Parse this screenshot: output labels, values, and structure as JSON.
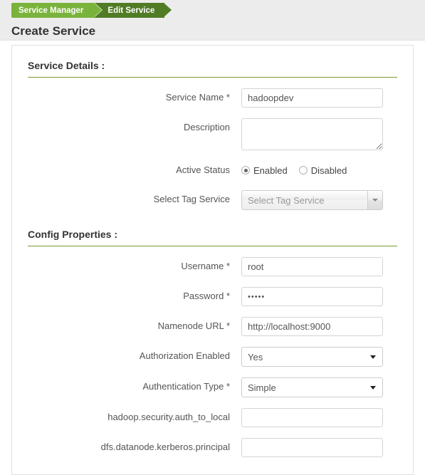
{
  "header": {
    "breadcrumb": [
      {
        "label": "Service Manager",
        "active": false
      },
      {
        "label": "Edit Service",
        "active": true
      }
    ],
    "page_title": "Create Service"
  },
  "colors": {
    "breadcrumb_first": "#7ab33c",
    "breadcrumb_second": "#517c26",
    "section_underline": "#7b9b2f",
    "header_band": "#ececec"
  },
  "sections": [
    {
      "heading": "Service Details :",
      "fields": [
        {
          "label": "Service Name *",
          "type": "text",
          "value": "hadoopdev",
          "placeholder": ""
        },
        {
          "label": "Description",
          "type": "textarea",
          "value": "",
          "placeholder": ""
        },
        {
          "label": "Active Status",
          "type": "radio",
          "options": [
            {
              "label": "Enabled",
              "selected": true
            },
            {
              "label": "Disabled",
              "selected": false
            }
          ]
        },
        {
          "label": "Select Tag Service",
          "type": "select2",
          "value": "Select Tag Service",
          "placeholder": "Select Tag Service",
          "arrow_icon": "chevron-down-icon"
        }
      ]
    },
    {
      "heading": "Config Properties :",
      "fields": [
        {
          "label": "Username *",
          "type": "text",
          "value": "root",
          "placeholder": ""
        },
        {
          "label": "Password *",
          "type": "password",
          "value": "•••••",
          "placeholder": ""
        },
        {
          "label": "Namenode URL *",
          "type": "text",
          "value": "http://localhost:9000",
          "placeholder": ""
        },
        {
          "label": "Authorization Enabled",
          "type": "select",
          "value": "Yes",
          "arrow_icon": "caret-down-icon"
        },
        {
          "label": "Authentication Type *",
          "type": "select",
          "value": "Simple",
          "arrow_icon": "caret-down-icon"
        },
        {
          "label": "hadoop.security.auth_to_local",
          "type": "text",
          "value": "",
          "placeholder": ""
        },
        {
          "label": "dfs.datanode.kerberos.principal",
          "type": "text",
          "value": "",
          "placeholder": ""
        }
      ]
    }
  ]
}
